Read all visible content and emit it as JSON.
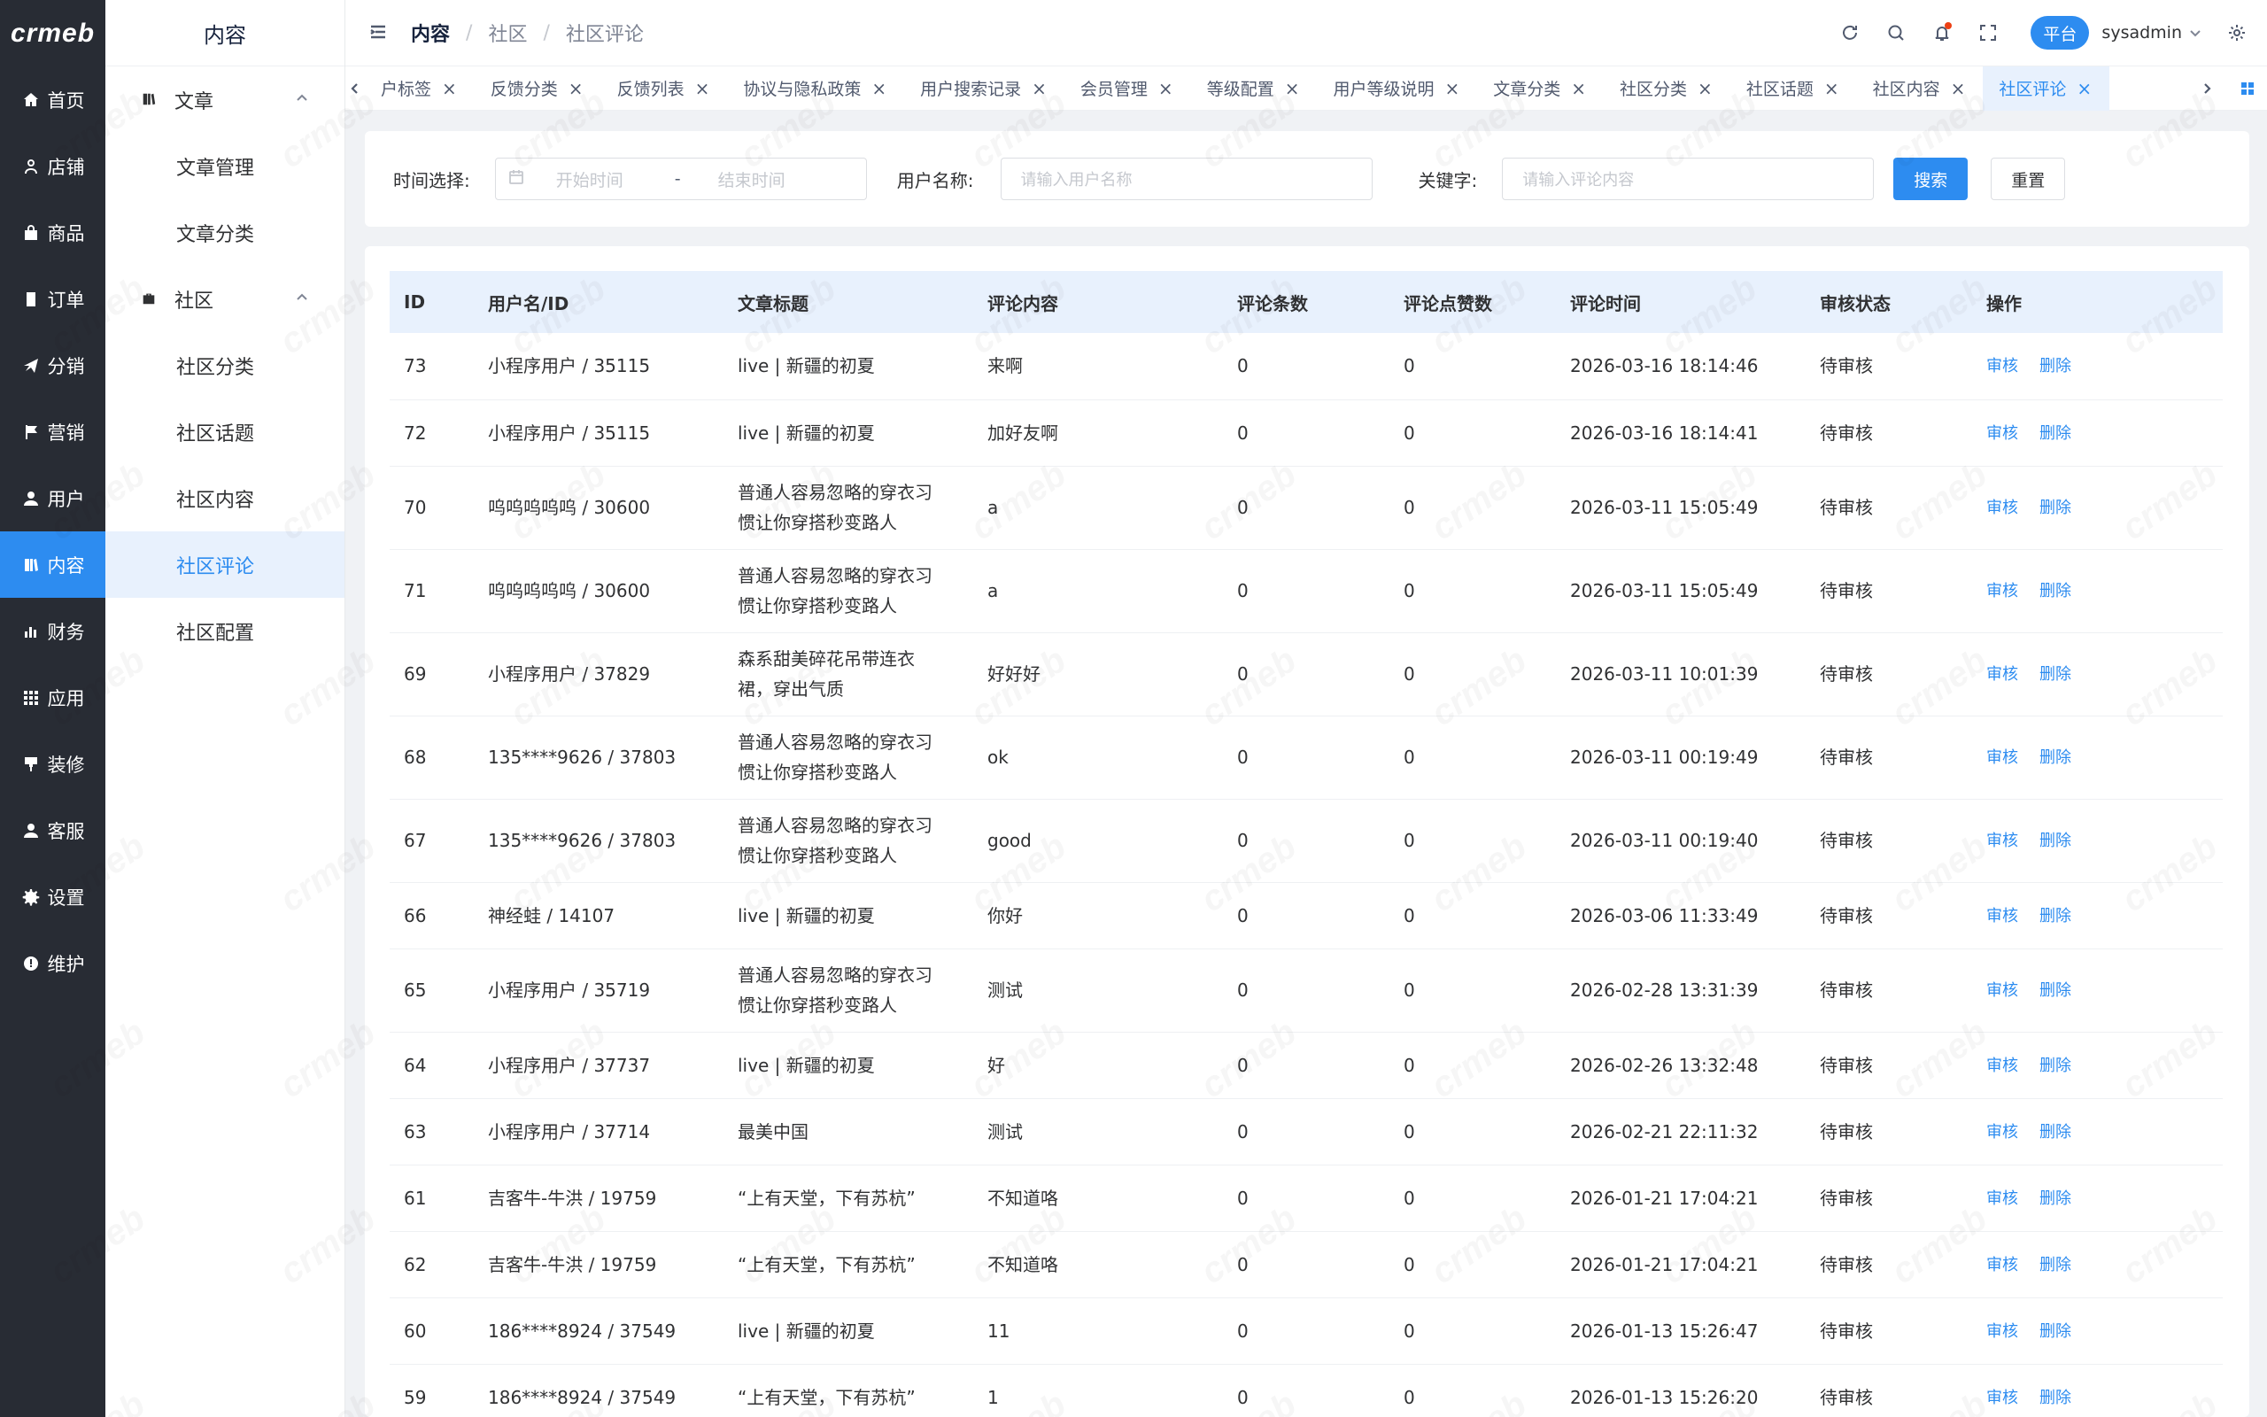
{
  "brand": {
    "logo_text": "crmeb"
  },
  "nav": {
    "items": [
      {
        "label": "首页",
        "icon": "home-icon",
        "active": false
      },
      {
        "label": "店铺",
        "icon": "store-icon",
        "active": false
      },
      {
        "label": "商品",
        "icon": "bag-icon",
        "active": false
      },
      {
        "label": "订单",
        "icon": "order-icon",
        "active": false
      },
      {
        "label": "分销",
        "icon": "send-icon",
        "active": false
      },
      {
        "label": "营销",
        "icon": "flag-icon",
        "active": false
      },
      {
        "label": "用户",
        "icon": "user-icon",
        "active": false
      },
      {
        "label": "内容",
        "icon": "content-icon",
        "active": true
      },
      {
        "label": "财务",
        "icon": "chart-icon",
        "active": false
      },
      {
        "label": "应用",
        "icon": "apps-icon",
        "active": false
      },
      {
        "label": "装修",
        "icon": "brush-icon",
        "active": false
      },
      {
        "label": "客服",
        "icon": "service-icon",
        "active": false
      },
      {
        "label": "设置",
        "icon": "gear-icon",
        "active": false
      },
      {
        "label": "维护",
        "icon": "maintain-icon",
        "active": false
      }
    ]
  },
  "submenu": {
    "title": "内容",
    "group1": {
      "label": "文章",
      "items": [
        "文章管理",
        "文章分类"
      ]
    },
    "group2": {
      "label": "社区",
      "items": [
        "社区分类",
        "社区话题",
        "社区内容",
        "社区评论",
        "社区配置"
      ]
    },
    "active_item": "社区评论"
  },
  "header": {
    "breadcrumb": [
      "内容",
      "社区",
      "社区评论"
    ],
    "platform_label": "平台",
    "username": "sysadmin"
  },
  "tabs": [
    {
      "label": "户标签",
      "active": false
    },
    {
      "label": "反馈分类",
      "active": false
    },
    {
      "label": "反馈列表",
      "active": false
    },
    {
      "label": "协议与隐私政策",
      "active": false
    },
    {
      "label": "用户搜索记录",
      "active": false
    },
    {
      "label": "会员管理",
      "active": false
    },
    {
      "label": "等级配置",
      "active": false
    },
    {
      "label": "用户等级说明",
      "active": false
    },
    {
      "label": "文章分类",
      "active": false
    },
    {
      "label": "社区分类",
      "active": false
    },
    {
      "label": "社区话题",
      "active": false
    },
    {
      "label": "社区内容",
      "active": false
    },
    {
      "label": "社区评论",
      "active": true
    }
  ],
  "filter": {
    "time_label": "时间选择:",
    "start_placeholder": "开始时间",
    "range_sep": "-",
    "end_placeholder": "结束时间",
    "user_label": "用户名称:",
    "user_placeholder": "请输入用户名称",
    "keyword_label": "关键字:",
    "keyword_placeholder": "请输入评论内容",
    "search_button": "搜索",
    "reset_button": "重置"
  },
  "table": {
    "columns": [
      "ID",
      "用户名/ID",
      "文章标题",
      "评论内容",
      "评论条数",
      "评论点赞数",
      "评论时间",
      "审核状态",
      "操作"
    ],
    "actions": {
      "review": "审核",
      "delete": "删除"
    },
    "rows": [
      {
        "id": "73",
        "user": "小程序用户 / 35115",
        "title": "live | 新疆的初夏",
        "content": "来啊",
        "count": "0",
        "likes": "0",
        "time": "2026-03-16 18:14:46",
        "status": "待审核"
      },
      {
        "id": "72",
        "user": "小程序用户 / 35115",
        "title": "live | 新疆的初夏",
        "content": "加好友啊",
        "count": "0",
        "likes": "0",
        "time": "2026-03-16 18:14:41",
        "status": "待审核"
      },
      {
        "id": "70",
        "user": "呜呜呜呜呜 / 30600",
        "title": "普通人容易忽略的穿衣习惯让你穿搭秒变路人",
        "content": "a",
        "count": "0",
        "likes": "0",
        "time": "2026-03-11 15:05:49",
        "status": "待审核"
      },
      {
        "id": "71",
        "user": "呜呜呜呜呜 / 30600",
        "title": "普通人容易忽略的穿衣习惯让你穿搭秒变路人",
        "content": "a",
        "count": "0",
        "likes": "0",
        "time": "2026-03-11 15:05:49",
        "status": "待审核"
      },
      {
        "id": "69",
        "user": "小程序用户 / 37829",
        "title": "森系甜美碎花吊带连衣裙，穿出气质",
        "content": "好好好",
        "count": "0",
        "likes": "0",
        "time": "2026-03-11 10:01:39",
        "status": "待审核"
      },
      {
        "id": "68",
        "user": "135****9626 / 37803",
        "title": "普通人容易忽略的穿衣习惯让你穿搭秒变路人",
        "content": "ok",
        "count": "0",
        "likes": "0",
        "time": "2026-03-11 00:19:49",
        "status": "待审核"
      },
      {
        "id": "67",
        "user": "135****9626 / 37803",
        "title": "普通人容易忽略的穿衣习惯让你穿搭秒变路人",
        "content": "good",
        "count": "0",
        "likes": "0",
        "time": "2026-03-11 00:19:40",
        "status": "待审核"
      },
      {
        "id": "66",
        "user": "神经蛙 / 14107",
        "title": "live | 新疆的初夏",
        "content": "你好",
        "count": "0",
        "likes": "0",
        "time": "2026-03-06 11:33:49",
        "status": "待审核"
      },
      {
        "id": "65",
        "user": "小程序用户 / 35719",
        "title": "普通人容易忽略的穿衣习惯让你穿搭秒变路人",
        "content": "测试",
        "count": "0",
        "likes": "0",
        "time": "2026-02-28 13:31:39",
        "status": "待审核"
      },
      {
        "id": "64",
        "user": "小程序用户 / 37737",
        "title": "live | 新疆的初夏",
        "content": "好",
        "count": "0",
        "likes": "0",
        "time": "2026-02-26 13:32:48",
        "status": "待审核"
      },
      {
        "id": "63",
        "user": "小程序用户 / 37714",
        "title": "最美中国",
        "content": "测试",
        "count": "0",
        "likes": "0",
        "time": "2026-02-21 22:11:32",
        "status": "待审核"
      },
      {
        "id": "61",
        "user": "吉客牛-牛洪 / 19759",
        "title": "“上有天堂，下有苏杭”",
        "content": "不知道咯",
        "count": "0",
        "likes": "0",
        "time": "2026-01-21 17:04:21",
        "status": "待审核"
      },
      {
        "id": "62",
        "user": "吉客牛-牛洪 / 19759",
        "title": "“上有天堂，下有苏杭”",
        "content": "不知道咯",
        "count": "0",
        "likes": "0",
        "time": "2026-01-21 17:04:21",
        "status": "待审核"
      },
      {
        "id": "60",
        "user": "186****8924 / 37549",
        "title": "live | 新疆的初夏",
        "content": "11",
        "count": "0",
        "likes": "0",
        "time": "2026-01-13 15:26:47",
        "status": "待审核"
      },
      {
        "id": "59",
        "user": "186****8924 / 37549",
        "title": "“上有天堂，下有苏杭”",
        "content": "1",
        "count": "0",
        "likes": "0",
        "time": "2026-01-13 15:26:20",
        "status": "待审核"
      }
    ]
  },
  "colors": {
    "primary": "#2d8cf0",
    "nav_bg": "#282c34",
    "header_row_bg": "#e8f1fd"
  }
}
